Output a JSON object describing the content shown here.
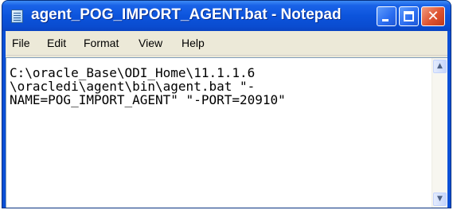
{
  "window": {
    "title": "agent_POG_IMPORT_AGENT.bat - Notepad",
    "app_icon": "notepad-icon",
    "controls": {
      "minimize_icon": "minimize-icon",
      "maximize_icon": "maximize-icon",
      "close_icon": "close-icon",
      "close_glyph": "✕"
    }
  },
  "menu": {
    "items": [
      {
        "label": "File"
      },
      {
        "label": "Edit"
      },
      {
        "label": "Format"
      },
      {
        "label": "View"
      },
      {
        "label": "Help"
      }
    ]
  },
  "editor": {
    "content": "C:\\oracle_Base\\ODI_Home\\11.1.1.6\n\\oracledi\\agent\\bin\\agent.bat \"-\nNAME=POG_IMPORT_AGENT\" \"-PORT=20910\""
  },
  "scrollbar": {
    "up_glyph": "▲",
    "down_glyph": "▼"
  },
  "colors": {
    "titlebar": "#0a4fd6",
    "close_button": "#de5330",
    "menubar": "#ece9d8"
  }
}
